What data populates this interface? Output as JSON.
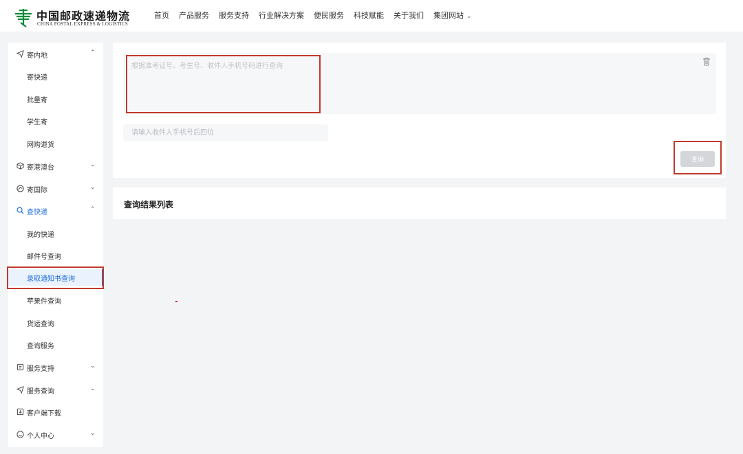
{
  "brand": {
    "name_cn": "中国邮政速递物流",
    "name_en": "CHINA POSTAL EXPRESS & LOGISTICS",
    "color": "#0a8a3a"
  },
  "nav": {
    "items": [
      "首页",
      "产品服务",
      "服务支持",
      "行业解决方案",
      "便民服务",
      "科技赋能",
      "关于我们",
      "集团网站"
    ]
  },
  "sidebar": {
    "groups": [
      {
        "label": "寄内地",
        "icon": "send-icon",
        "expanded": true
      },
      {
        "label": "寄快递"
      },
      {
        "label": "批量寄"
      },
      {
        "label": "学生寄"
      },
      {
        "label": "网购退货"
      },
      {
        "label": "寄港澳台",
        "icon": "box-icon",
        "expanded": false
      },
      {
        "label": "寄国际",
        "icon": "globe-icon",
        "expanded": false
      },
      {
        "label": "查快递",
        "icon": "search-icon",
        "expanded": true
      },
      {
        "label": "我的快递"
      },
      {
        "label": "邮件号查询"
      },
      {
        "label": "录取通知书查询"
      },
      {
        "label": "苹果件查询"
      },
      {
        "label": "货运查询"
      },
      {
        "label": "查询服务"
      },
      {
        "label": "服务支持",
        "icon": "support-icon",
        "expanded": false
      },
      {
        "label": "服务查询",
        "icon": "service-icon",
        "expanded": false
      },
      {
        "label": "客户端下载",
        "icon": "download-icon"
      },
      {
        "label": "个人中心",
        "icon": "user-icon",
        "expanded": false
      }
    ]
  },
  "form": {
    "query_placeholder": "根据准考证号、考生号、收件人手机号码进行查询",
    "phone_placeholder": "请输入收件人手机号后四位",
    "query_button": "查询"
  },
  "results": {
    "title": "查询结果列表"
  },
  "colors": {
    "accent": "#1e6fd9",
    "highlight_box": "#c0392b",
    "button_disabled": "#d4d6d9"
  }
}
